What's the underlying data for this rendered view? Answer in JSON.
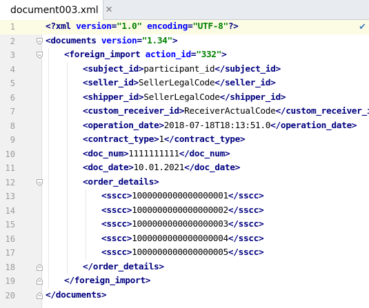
{
  "tab": {
    "filename": "document003.xml",
    "close_icon": "close-icon",
    "file_icon": "xml-file-icon"
  },
  "editor": {
    "check_icon": "inspection-ok-icon",
    "current_line": 1,
    "lines": [
      {
        "n": "1",
        "indent": 0,
        "fold": "",
        "parts": [
          [
            "t",
            "<?"
          ],
          [
            "t",
            "xml "
          ],
          [
            "a",
            "version"
          ],
          [
            "t",
            "="
          ],
          [
            "v",
            "\"1.0\""
          ],
          [
            "t",
            " "
          ],
          [
            "a",
            "encoding"
          ],
          [
            "t",
            "="
          ],
          [
            "v",
            "\"UTF-8\""
          ],
          [
            "t",
            "?>"
          ]
        ]
      },
      {
        "n": "2",
        "indent": 0,
        "fold": "open",
        "parts": [
          [
            "t",
            "<documents "
          ],
          [
            "a",
            "version"
          ],
          [
            "t",
            "="
          ],
          [
            "v",
            "\"1.34\""
          ],
          [
            "t",
            ">"
          ]
        ]
      },
      {
        "n": "3",
        "indent": 1,
        "fold": "open",
        "parts": [
          [
            "t",
            "<foreign_import "
          ],
          [
            "a",
            "action_id"
          ],
          [
            "t",
            "="
          ],
          [
            "v",
            "\"332\""
          ],
          [
            "t",
            ">"
          ]
        ]
      },
      {
        "n": "4",
        "indent": 2,
        "fold": "",
        "parts": [
          [
            "t",
            "<subject_id>"
          ],
          [
            "x",
            "participant_id"
          ],
          [
            "t",
            "</subject_id>"
          ]
        ]
      },
      {
        "n": "5",
        "indent": 2,
        "fold": "",
        "parts": [
          [
            "t",
            "<seller_id>"
          ],
          [
            "x",
            "SellerLegalCode"
          ],
          [
            "t",
            "</seller_id>"
          ]
        ]
      },
      {
        "n": "6",
        "indent": 2,
        "fold": "",
        "parts": [
          [
            "t",
            "<shipper_id>"
          ],
          [
            "x",
            "SellerLegalCode"
          ],
          [
            "t",
            "</shipper_id>"
          ]
        ]
      },
      {
        "n": "7",
        "indent": 2,
        "fold": "",
        "parts": [
          [
            "t",
            "<custom_receiver_id>"
          ],
          [
            "x",
            "ReceiverActualCode"
          ],
          [
            "t",
            "</custom_receiver_id>"
          ]
        ]
      },
      {
        "n": "8",
        "indent": 2,
        "fold": "",
        "parts": [
          [
            "t",
            "<operation_date>"
          ],
          [
            "x",
            "2018-07-18T18:13:51.0"
          ],
          [
            "t",
            "</operation_date>"
          ]
        ]
      },
      {
        "n": "9",
        "indent": 2,
        "fold": "",
        "parts": [
          [
            "t",
            "<contract_type>"
          ],
          [
            "x",
            "1"
          ],
          [
            "t",
            "</contract_type>"
          ]
        ]
      },
      {
        "n": "10",
        "indent": 2,
        "fold": "",
        "parts": [
          [
            "t",
            "<doc_num>"
          ],
          [
            "x",
            "1111111111"
          ],
          [
            "t",
            "</doc_num>"
          ]
        ]
      },
      {
        "n": "11",
        "indent": 2,
        "fold": "",
        "parts": [
          [
            "t",
            "<doc_date>"
          ],
          [
            "x",
            "10.01.2021"
          ],
          [
            "t",
            "</doc_date>"
          ]
        ]
      },
      {
        "n": "12",
        "indent": 2,
        "fold": "open",
        "parts": [
          [
            "t",
            "<order_details>"
          ]
        ]
      },
      {
        "n": "13",
        "indent": 3,
        "fold": "",
        "parts": [
          [
            "t",
            "<sscc>"
          ],
          [
            "x",
            "1000000000000000001"
          ],
          [
            "t",
            "</sscc>"
          ]
        ]
      },
      {
        "n": "14",
        "indent": 3,
        "fold": "",
        "parts": [
          [
            "t",
            "<sscc>"
          ],
          [
            "x",
            "1000000000000000002"
          ],
          [
            "t",
            "</sscc>"
          ]
        ]
      },
      {
        "n": "15",
        "indent": 3,
        "fold": "",
        "parts": [
          [
            "t",
            "<sscc>"
          ],
          [
            "x",
            "1000000000000000003"
          ],
          [
            "t",
            "</sscc>"
          ]
        ]
      },
      {
        "n": "16",
        "indent": 3,
        "fold": "",
        "parts": [
          [
            "t",
            "<sscc>"
          ],
          [
            "x",
            "1000000000000000004"
          ],
          [
            "t",
            "</sscc>"
          ]
        ]
      },
      {
        "n": "17",
        "indent": 3,
        "fold": "",
        "parts": [
          [
            "t",
            "<sscc>"
          ],
          [
            "x",
            "1000000000000000005"
          ],
          [
            "t",
            "</sscc>"
          ]
        ]
      },
      {
        "n": "18",
        "indent": 2,
        "fold": "close",
        "parts": [
          [
            "t",
            "</order_details>"
          ]
        ]
      },
      {
        "n": "19",
        "indent": 1,
        "fold": "close",
        "parts": [
          [
            "t",
            "</foreign_import>"
          ]
        ]
      },
      {
        "n": "20",
        "indent": 0,
        "fold": "close",
        "parts": [
          [
            "t",
            "</documents>"
          ]
        ]
      }
    ]
  }
}
